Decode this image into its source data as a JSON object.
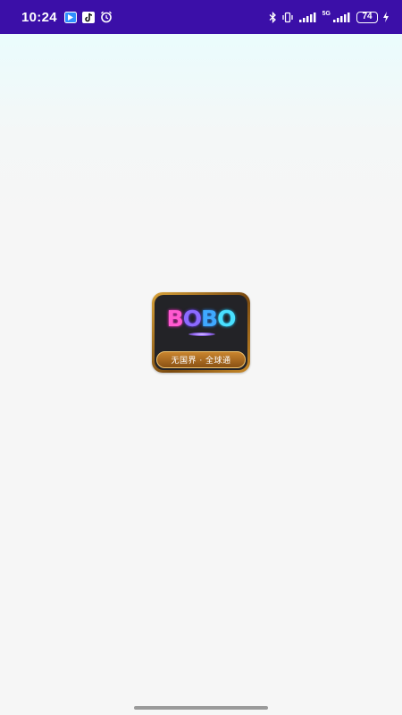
{
  "status_bar": {
    "time": "10:24",
    "network_label": "5G",
    "battery_level": "74",
    "background_color": "#3b0fa8",
    "notification_icons": [
      "app-notification-icon",
      "tiktok-icon",
      "alarm-clock-icon"
    ],
    "system_icons": [
      "bluetooth-icon",
      "vibrate-icon",
      "signal-icon",
      "signal-icon",
      "battery-icon",
      "charging-icon"
    ]
  },
  "splash": {
    "logo_text": {
      "b1": "B",
      "o1": "O",
      "b2": "B",
      "o2": "O"
    },
    "logo_tagline": "无国界 · 全球通",
    "logo_colors": {
      "frame": "#c88a2a",
      "tile": "#232327",
      "pink": "#ff5ad0",
      "purple": "#8c6bff",
      "blue": "#3fa9ff",
      "cyan": "#49e0ff"
    },
    "page_background": "#f6f6f6"
  }
}
